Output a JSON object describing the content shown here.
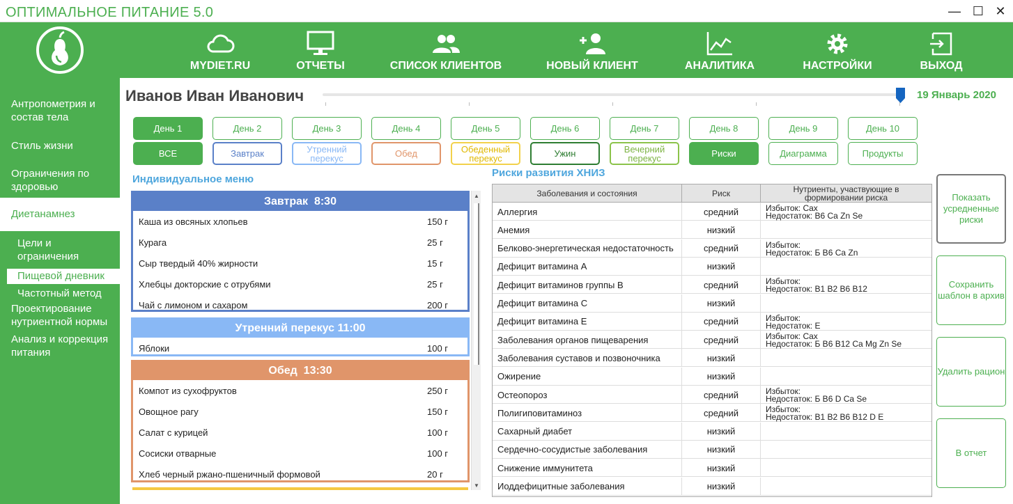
{
  "window": {
    "title": "ОПТИМАЛЬНОЕ ПИТАНИЕ 5.0",
    "min_icon": "—",
    "max_icon": "☐",
    "close_icon": "✕"
  },
  "nav": [
    {
      "label": "MYDIET.RU",
      "icon": "cloud-icon"
    },
    {
      "label": "ОТЧЕТЫ",
      "icon": "monitor-icon"
    },
    {
      "label": "СПИСОК КЛИЕНТОВ",
      "icon": "users-icon"
    },
    {
      "label": "НОВЫЙ КЛИЕНТ",
      "icon": "add-user-icon"
    },
    {
      "label": "АНАЛИТИКА",
      "icon": "chart-icon"
    },
    {
      "label": "НАСТРОЙКИ",
      "icon": "gear-icon"
    },
    {
      "label": "ВЫХОД",
      "icon": "exit-icon"
    }
  ],
  "sidebar": {
    "items": [
      {
        "label": "Антропометрия и состав тела"
      },
      {
        "label": "Стиль жизни"
      },
      {
        "label": "Ограничения по здоровью"
      },
      {
        "label": "Диетанамнез",
        "active": true
      },
      {
        "label": "Цели и ограничения",
        "sub": true
      },
      {
        "label": "Пищевой дневник",
        "sub": true,
        "active": true
      },
      {
        "label": "Частотный метод",
        "sub": true
      },
      {
        "label": "Проектирование нутриентной нормы"
      },
      {
        "label": "Анализ и коррекция питания"
      }
    ]
  },
  "client": {
    "name": "Иванов Иван Иванович",
    "date": "19 Январь 2020"
  },
  "days": [
    "День 1",
    "День 2",
    "День 3",
    "День 4",
    "День 5",
    "День 6",
    "День 7",
    "День 8",
    "День 9",
    "День 10"
  ],
  "meal_tabs": [
    {
      "label": "ВСЕ",
      "color": "#4caf50"
    },
    {
      "label": "Завтрак",
      "color": "#5a80c8"
    },
    {
      "label": "Утренний перекус",
      "color": "#89b8f5"
    },
    {
      "label": "Обед",
      "color": "#e0956a"
    },
    {
      "label": "Обеденный перекус",
      "color": "#f2d14b"
    },
    {
      "label": "Ужин",
      "color": "#2e7d32"
    },
    {
      "label": "Вечерний перекус",
      "color": "#8bc34a"
    }
  ],
  "view_tabs": [
    "Риски",
    "Диаграмма",
    "Продукты"
  ],
  "menu": {
    "title": "Индивидуальное меню",
    "meals": [
      {
        "name": "Завтрак",
        "time": "8:30",
        "color": "#5a80c8",
        "items": [
          {
            "name": "Каша из овсяных хлопьев",
            "qty": "150 г"
          },
          {
            "name": "Курага",
            "qty": "25 г"
          },
          {
            "name": "Сыр твердый 40% жирности",
            "qty": "15 г"
          },
          {
            "name": "Хлебцы докторские с отрубями",
            "qty": "25 г"
          },
          {
            "name": "Чай с лимоном и сахаром",
            "qty": "200 г"
          }
        ]
      },
      {
        "name": "Утренний перекус",
        "time": "11:00",
        "color": "#89b8f5",
        "items": [
          {
            "name": "Яблоки",
            "qty": "100 г"
          }
        ]
      },
      {
        "name": "Обед",
        "time": "13:30",
        "color": "#e0956a",
        "items": [
          {
            "name": "Компот из сухофруктов",
            "qty": "250 г"
          },
          {
            "name": "Овощное рагу",
            "qty": "150 г"
          },
          {
            "name": "Салат с курицей",
            "qty": "100 г"
          },
          {
            "name": "Сосиски отварные",
            "qty": "100 г"
          },
          {
            "name": "Хлеб черный ржано-пшеничный формовой",
            "qty": "20 г"
          }
        ]
      }
    ]
  },
  "risks": {
    "title": "Риски развития ХНИЗ",
    "columns": [
      "Заболевания и состояния",
      "Риск",
      "Нутриенты, участвующие в формировании риска"
    ],
    "rows": [
      {
        "disease": "Аллергия",
        "risk": "средний",
        "excess": "Избыток: Cax",
        "deficit": "Недостаток: B6  Ca  Zn  Se"
      },
      {
        "disease": "Анемия",
        "risk": "низкий",
        "excess": "",
        "deficit": ""
      },
      {
        "disease": "Белково-энергетическая недостаточность",
        "risk": "средний",
        "excess": "Избыток:",
        "deficit": "Недостаток: Б   B6  Ca  Zn"
      },
      {
        "disease": "Дефицит витамина А",
        "risk": "низкий",
        "excess": "",
        "deficit": ""
      },
      {
        "disease": "Дефицит витаминов группы В",
        "risk": "средний",
        "excess": "Избыток:",
        "deficit": "Недостаток: B1  B2  B6  B12"
      },
      {
        "disease": "Дефицит витамина С",
        "risk": "низкий",
        "excess": "",
        "deficit": ""
      },
      {
        "disease": "Дефицит витамина Е",
        "risk": "средний",
        "excess": "Избыток:",
        "deficit": "Недостаток: E"
      },
      {
        "disease": "Заболевания органов пищеварения",
        "risk": "средний",
        "excess": "Избыток: Cax",
        "deficit": "Недостаток: Б   B6  B12 Ca  Mg  Zn  Se"
      },
      {
        "disease": "Заболевания суставов и позвоночника",
        "risk": "низкий",
        "excess": "",
        "deficit": ""
      },
      {
        "disease": "Ожирение",
        "risk": "низкий",
        "excess": "",
        "deficit": ""
      },
      {
        "disease": "Остеопороз",
        "risk": "средний",
        "excess": "Избыток:",
        "deficit": "Недостаток: Б   B6  D    Ca  Se"
      },
      {
        "disease": "Полигиповитаминоз",
        "risk": "средний",
        "excess": "Избыток:",
        "deficit": "Недостаток: B1  B2  B6  B12 D    E"
      },
      {
        "disease": "Сахарный диабет",
        "risk": "низкий",
        "excess": "",
        "deficit": ""
      },
      {
        "disease": "Сердечно-сосудистые заболевания",
        "risk": "низкий",
        "excess": "",
        "deficit": ""
      },
      {
        "disease": "Снижение иммунитета",
        "risk": "низкий",
        "excess": "",
        "deficit": ""
      },
      {
        "disease": "Иоддефицитные заболевания",
        "risk": "низкий",
        "excess": "",
        "deficit": ""
      }
    ]
  },
  "actions": [
    "Показать усредненные риски",
    "Сохранить шаблон в архив",
    "Удалить рацион",
    "В отчет"
  ],
  "colors": {
    "brand": "#4caf50",
    "section_title": "#4ea6dd"
  }
}
